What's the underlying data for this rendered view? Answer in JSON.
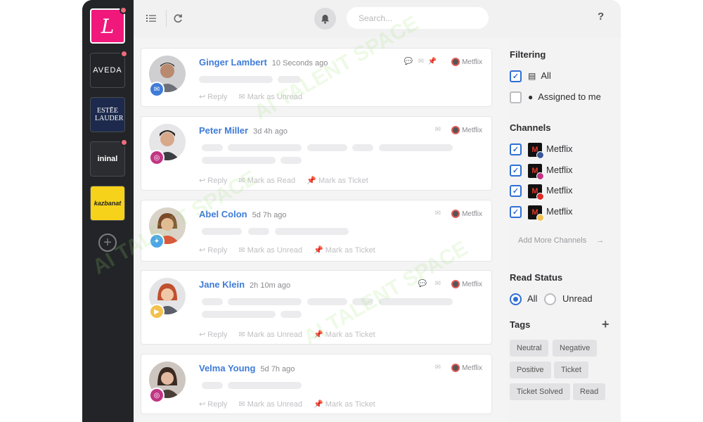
{
  "brands": [
    {
      "label": "L",
      "notify": true
    },
    {
      "label": "AVEDA",
      "notify": true
    },
    {
      "label": "ESTĒE LAUDER",
      "notify": false
    },
    {
      "label": "ininal",
      "notify": true
    },
    {
      "label": "kazbanat",
      "notify": false
    }
  ],
  "topbar": {
    "search_placeholder": "Search...",
    "help": "?"
  },
  "messages": [
    {
      "name": "Ginger Lambert",
      "time": "10 Seconds ago",
      "source": "messenger",
      "channel": "Metflix",
      "actions": [
        "Reply",
        "Mark as Unread"
      ]
    },
    {
      "name": "Peter Miller",
      "time": "3d 4h ago",
      "source": "instagram",
      "channel": "Metflix",
      "actions": [
        "Reply",
        "Mark as Read",
        "Mark as Ticket"
      ]
    },
    {
      "name": "Abel Colon",
      "time": "5d 7h ago",
      "source": "twitter",
      "channel": "Metflix",
      "actions": [
        "Reply",
        "Mark as Unread",
        "Mark as Ticket"
      ]
    },
    {
      "name": "Jane Klein",
      "time": "2h 10m ago",
      "source": "play-store",
      "channel": "Metflix",
      "actions": [
        "Reply",
        "Mark as Unread",
        "Mark as Ticket"
      ]
    },
    {
      "name": "Velma Young",
      "time": "5d 7h ago",
      "source": "instagram",
      "channel": "Metflix",
      "actions": [
        "Reply",
        "Mark as Unread",
        "Mark as Ticket"
      ]
    }
  ],
  "filters": {
    "title": "Filtering",
    "all_label": "All",
    "assigned_label": "Assigned to me",
    "channels_title": "Channels",
    "channels": [
      {
        "name": "Metflix",
        "badge": "facebook",
        "badge_color": "#3b5998"
      },
      {
        "name": "Metflix",
        "badge": "instagram",
        "badge_color": "#c13584"
      },
      {
        "name": "Metflix",
        "badge": "youtube",
        "badge_color": "#e02b2b"
      },
      {
        "name": "Metflix",
        "badge": "play-store",
        "badge_color": "#f2c14e"
      }
    ],
    "add_channels": "Add More Channels",
    "read_status_title": "Read Status",
    "read_all": "All",
    "read_unread": "Unread",
    "tags_title": "Tags",
    "tags": [
      "Neutral",
      "Negative",
      "Positive",
      "Ticket",
      "Ticket Solved",
      "Read"
    ]
  },
  "watermark": "AI TALENT SPACE",
  "colors": {
    "accent": "#3f7bd8",
    "rail": "#222427",
    "brand_pink": "#f0187b"
  }
}
